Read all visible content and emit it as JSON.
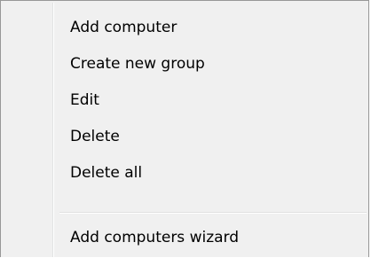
{
  "context_menu": {
    "items": [
      {
        "label": "Add computer"
      },
      {
        "label": "Create new group"
      },
      {
        "label": "Edit"
      },
      {
        "label": "Delete"
      },
      {
        "label": "Delete all"
      }
    ],
    "footer_items": [
      {
        "label": "Add computers wizard"
      }
    ]
  }
}
